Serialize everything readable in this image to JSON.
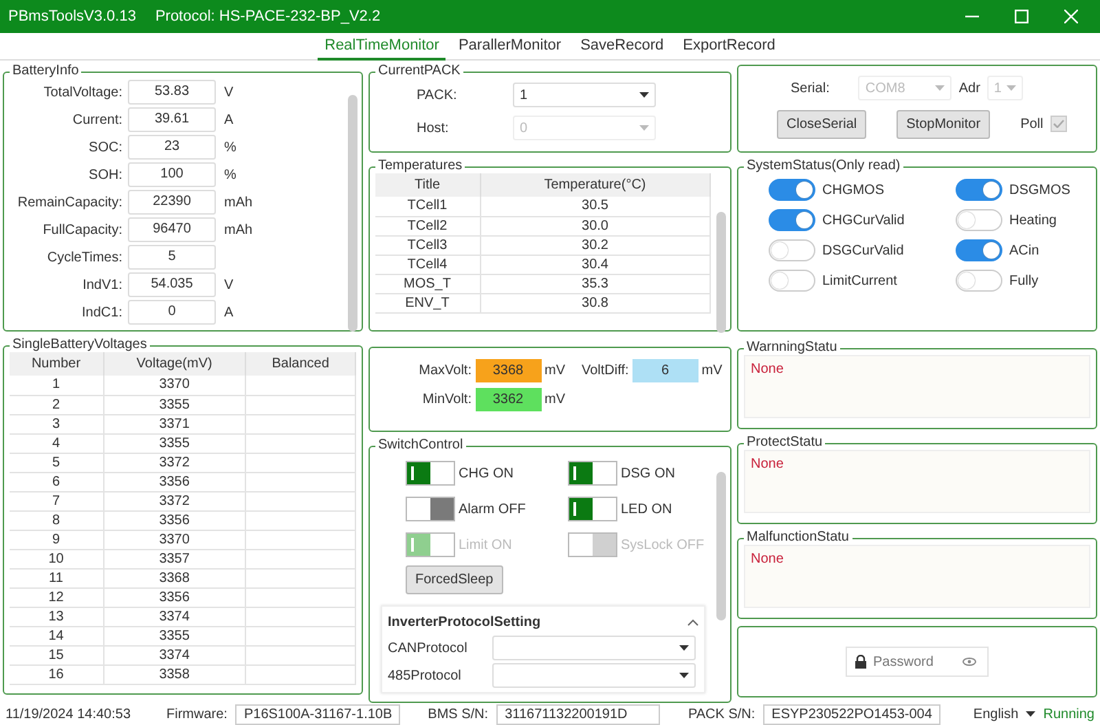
{
  "window": {
    "title": "PBmsToolsV3.0.13",
    "protocol": "Protocol: HS-PACE-232-BP_V2.2"
  },
  "tabs": [
    {
      "label": "RealTimeMonitor",
      "selected": true
    },
    {
      "label": "ParallerMonitor",
      "selected": false
    },
    {
      "label": "SaveRecord",
      "selected": false
    },
    {
      "label": "ExportRecord",
      "selected": false
    }
  ],
  "battery_info": {
    "title": "BatteryInfo",
    "fields": [
      {
        "label": "TotalVoltage:",
        "value": "53.83",
        "unit": "V"
      },
      {
        "label": "Current:",
        "value": "39.61",
        "unit": "A"
      },
      {
        "label": "SOC:",
        "value": "23",
        "unit": "%"
      },
      {
        "label": "SOH:",
        "value": "100",
        "unit": "%"
      },
      {
        "label": "RemainCapacity:",
        "value": "22390",
        "unit": "mAh"
      },
      {
        "label": "FullCapacity:",
        "value": "96470",
        "unit": "mAh"
      },
      {
        "label": "CycleTimes:",
        "value": "5"
      },
      {
        "label": "IndV1:",
        "value": "54.035",
        "unit": "V"
      },
      {
        "label": "IndC1:",
        "value": "0",
        "unit": "A"
      }
    ]
  },
  "current_pack": {
    "title": "CurrentPACK",
    "fields": [
      {
        "label": "PACK:",
        "value": "1",
        "disabled": false
      },
      {
        "label": "Host:",
        "value": "0",
        "disabled": true
      }
    ]
  },
  "connection": {
    "serial": {
      "label": "Serial:",
      "value": "COM8",
      "disabled": true
    },
    "adr": {
      "label": "Adr",
      "value": "1",
      "disabled": true
    },
    "buttons": [
      "CloseSerial",
      "StopMonitor"
    ],
    "poll": {
      "label": "Poll",
      "checked": true,
      "disabled": true
    }
  },
  "temperatures": {
    "title": "Temperatures",
    "columns": [
      "Title",
      "Temperature(°C)"
    ],
    "rows": [
      [
        "TCell1",
        "30.5"
      ],
      [
        "TCell2",
        "30.0"
      ],
      [
        "TCell3",
        "30.2"
      ],
      [
        "TCell4",
        "30.4"
      ],
      [
        "MOS_T",
        "35.3"
      ],
      [
        "ENV_T",
        "30.8"
      ]
    ]
  },
  "system_status": {
    "title": "SystemStatus(Only read)",
    "items": [
      {
        "label": "CHGMOS",
        "on": true
      },
      {
        "label": "DSGMOS",
        "on": true
      },
      {
        "label": "CHGCurValid",
        "on": true
      },
      {
        "label": "Heating",
        "on": false
      },
      {
        "label": "DSGCurValid",
        "on": false
      },
      {
        "label": "ACin",
        "on": true
      },
      {
        "label": "LimitCurrent",
        "on": false
      },
      {
        "label": "Fully",
        "on": false
      }
    ]
  },
  "cell_voltages": {
    "title": "SingleBatteryVoltages",
    "columns": [
      "Number",
      "Voltage(mV)",
      "Balanced"
    ],
    "rows": [
      [
        "1",
        "3370"
      ],
      [
        "2",
        "3355"
      ],
      [
        "3",
        "3371"
      ],
      [
        "4",
        "3355"
      ],
      [
        "5",
        "3372"
      ],
      [
        "6",
        "3356"
      ],
      [
        "7",
        "3372"
      ],
      [
        "8",
        "3356"
      ],
      [
        "9",
        "3370"
      ],
      [
        "10",
        "3357"
      ],
      [
        "11",
        "3368"
      ],
      [
        "12",
        "3356"
      ],
      [
        "13",
        "3374"
      ],
      [
        "14",
        "3355"
      ],
      [
        "15",
        "3374"
      ],
      [
        "16",
        "3358"
      ]
    ]
  },
  "volt_summary": {
    "items": [
      {
        "label": "MaxVolt:",
        "value": "3368",
        "unit": "mV",
        "color": "#f7a21b"
      },
      {
        "label": "VoltDiff:",
        "value": "6",
        "unit": "mV",
        "color": "#aee0f5"
      },
      {
        "label": "MinVolt:",
        "value": "3362",
        "unit": "mV",
        "color": "#5ee05e"
      }
    ]
  },
  "switch_control": {
    "title": "SwitchControl",
    "switches": [
      {
        "label": "CHG ON",
        "on": true,
        "disabled": false
      },
      {
        "label": "DSG ON",
        "on": true,
        "disabled": false
      },
      {
        "label": "Alarm OFF",
        "on": false,
        "disabled": false
      },
      {
        "label": "LED ON",
        "on": true,
        "disabled": false
      },
      {
        "label": "Limit ON",
        "on": true,
        "disabled": true
      },
      {
        "label": "SysLock OFF",
        "on": false,
        "disabled": true
      }
    ],
    "button": "ForcedSleep",
    "inverter_protocol": {
      "title": "InverterProtocolSetting",
      "expanded": true,
      "fields": [
        {
          "label": "CANProtocol"
        },
        {
          "label": "485Protocol"
        }
      ]
    }
  },
  "statuses": [
    {
      "title": "WarnningStatu",
      "text": "None"
    },
    {
      "title": "ProtectStatu",
      "text": "None"
    },
    {
      "title": "MalfunctionStatu",
      "text": "None"
    }
  ],
  "login": {
    "placeholder": "Password"
  },
  "status_bar": {
    "datetime": "11/19/2024 14:40:53",
    "fields": [
      {
        "label": "Firmware:",
        "value": "P16S100A-31167-1.10B"
      },
      {
        "label": "BMS S/N:",
        "value": "311671132200191D"
      },
      {
        "label": "PACK S/N:",
        "value": "ESYP230522PO1453-004"
      }
    ],
    "language": "English",
    "state": "Running"
  }
}
